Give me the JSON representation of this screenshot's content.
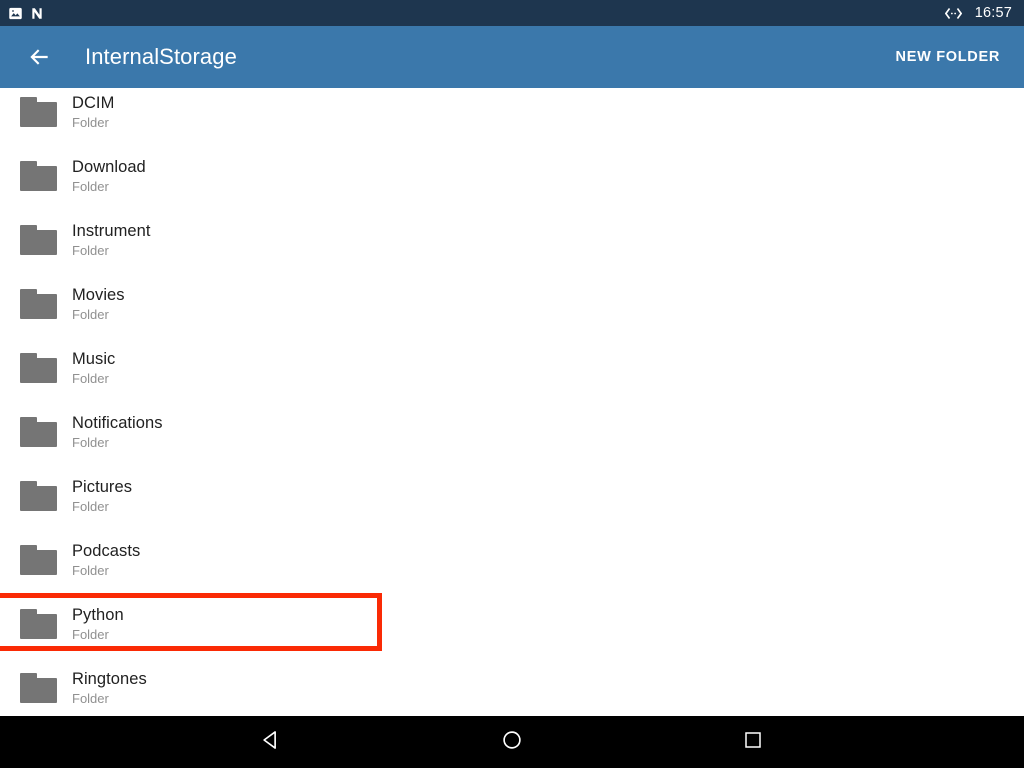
{
  "status_bar": {
    "icons": [
      {
        "name": "image-notification-icon"
      },
      {
        "name": "nfc-n-icon"
      }
    ],
    "right_icons": [
      {
        "name": "usb-debugging-icon"
      }
    ],
    "clock": "16:57",
    "background_color": "#1e364f"
  },
  "app_bar": {
    "back_icon": "back-arrow-icon",
    "title": "InternalStorage",
    "action_label": "NEW FOLDER",
    "background_color": "#3b78ab"
  },
  "file_list": {
    "subtitle_label": "Folder",
    "highlight_color": "#fa2a05",
    "items": [
      {
        "name": "DCIM",
        "type": "Folder",
        "icon": "folder-icon",
        "highlighted": false
      },
      {
        "name": "Download",
        "type": "Folder",
        "icon": "folder-icon",
        "highlighted": false
      },
      {
        "name": "Instrument",
        "type": "Folder",
        "icon": "folder-icon",
        "highlighted": false
      },
      {
        "name": "Movies",
        "type": "Folder",
        "icon": "folder-icon",
        "highlighted": false
      },
      {
        "name": "Music",
        "type": "Folder",
        "icon": "folder-icon",
        "highlighted": false
      },
      {
        "name": "Notifications",
        "type": "Folder",
        "icon": "folder-icon",
        "highlighted": false
      },
      {
        "name": "Pictures",
        "type": "Folder",
        "icon": "folder-icon",
        "highlighted": false
      },
      {
        "name": "Podcasts",
        "type": "Folder",
        "icon": "folder-icon",
        "highlighted": false
      },
      {
        "name": "Python",
        "type": "Folder",
        "icon": "folder-icon",
        "highlighted": true
      },
      {
        "name": "Ringtones",
        "type": "Folder",
        "icon": "folder-icon",
        "highlighted": false
      }
    ]
  },
  "nav_bar": {
    "buttons": [
      {
        "name": "back-nav-button",
        "icon": "triangle-back-icon"
      },
      {
        "name": "home-nav-button",
        "icon": "circle-home-icon"
      },
      {
        "name": "recents-nav-button",
        "icon": "square-recents-icon"
      }
    ],
    "background_color": "#000000"
  }
}
